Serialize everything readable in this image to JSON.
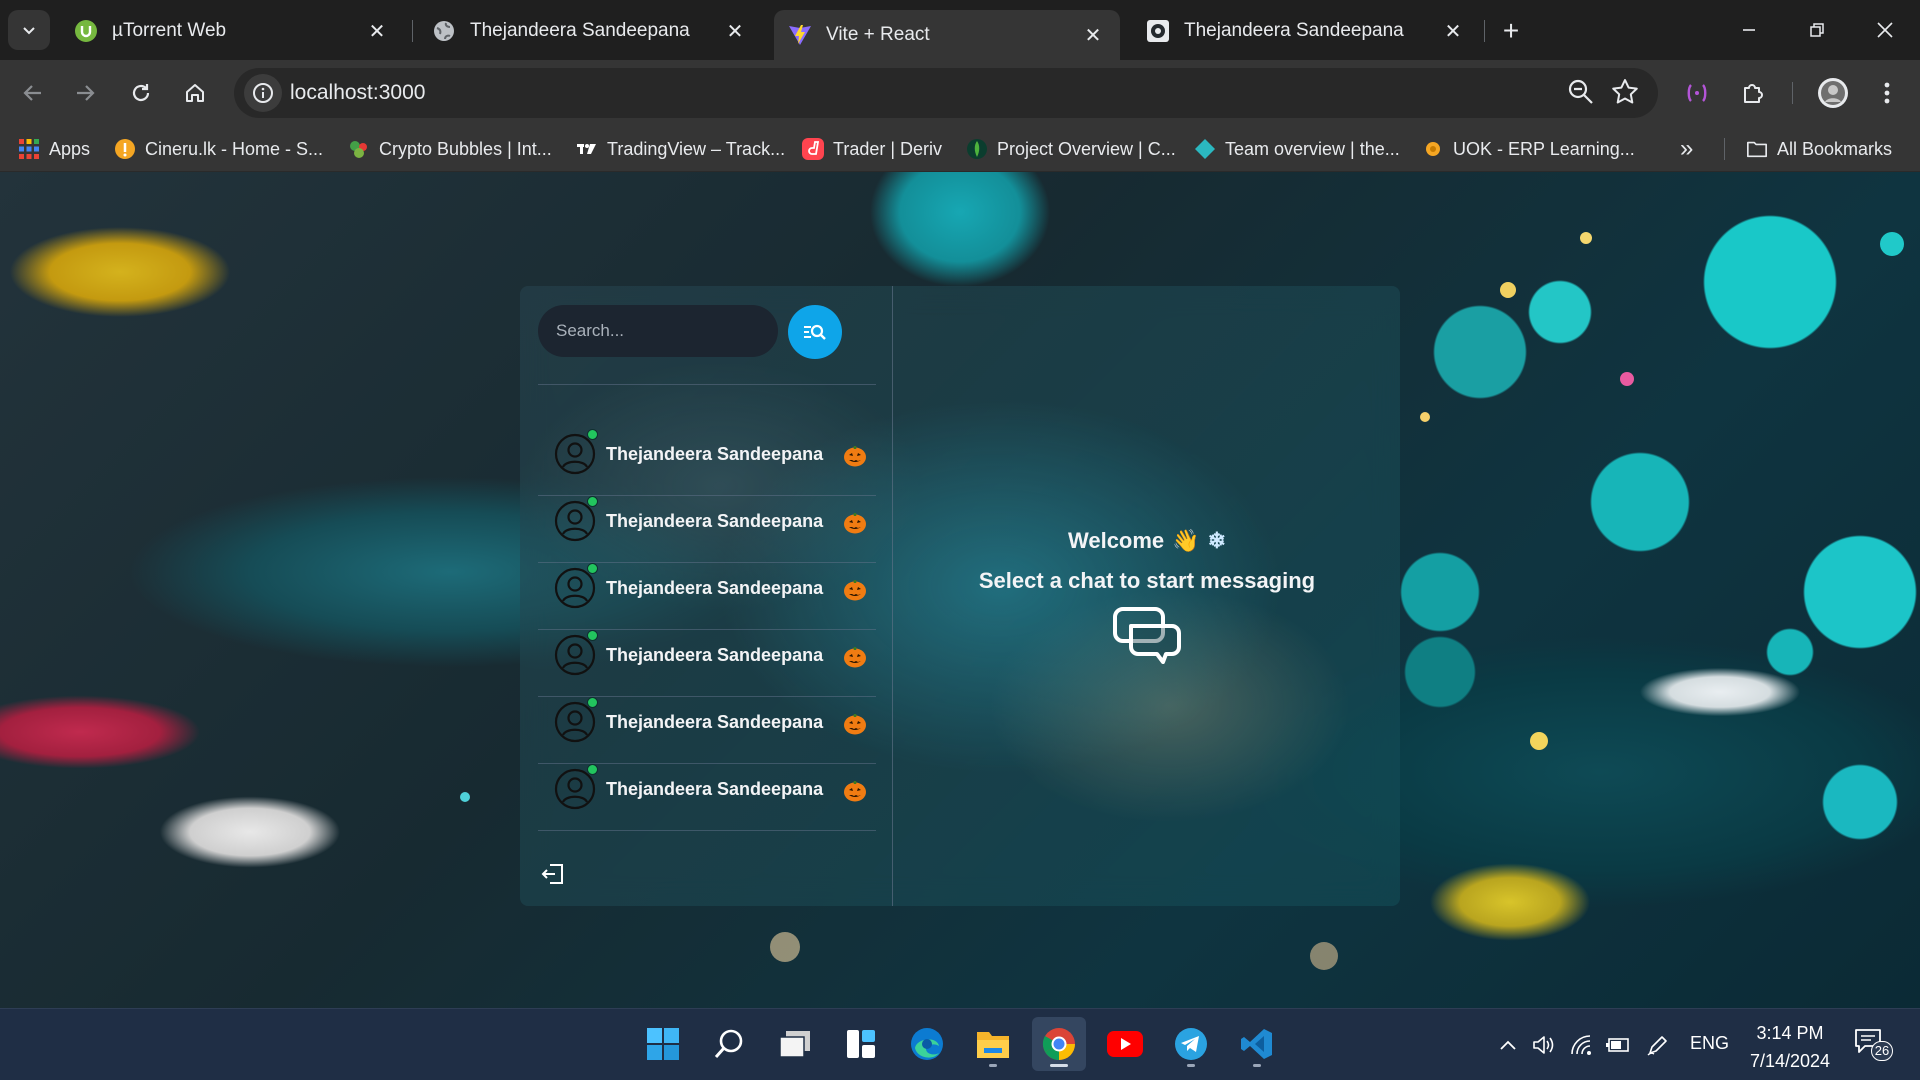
{
  "browser": {
    "tabs": [
      {
        "title": "µTorrent Web",
        "icon": "utorrent-icon",
        "active": false
      },
      {
        "title": "Thejandeera Sandeepana",
        "icon": "globe-icon",
        "active": false
      },
      {
        "title": "Vite + React",
        "icon": "vite-icon",
        "active": true
      },
      {
        "title": "Thejandeera Sandeepana",
        "icon": "github-icon",
        "active": false
      }
    ],
    "close_glyph": "✕",
    "new_tab_glyph": "+",
    "url": "localhost:3000",
    "bookmarks": [
      {
        "label": "Apps",
        "icon": "apps-grid-icon"
      },
      {
        "label": "Cineru.lk - Home - S...",
        "icon": "cineru-icon"
      },
      {
        "label": "Crypto Bubbles | Int...",
        "icon": "crypto-bubbles-icon"
      },
      {
        "label": "TradingView – Track...",
        "icon": "tradingview-icon"
      },
      {
        "label": "Trader | Deriv",
        "icon": "deriv-icon"
      },
      {
        "label": "Project Overview | C...",
        "icon": "mongodb-icon"
      },
      {
        "label": "Team overview | the...",
        "icon": "diamond-icon"
      },
      {
        "label": "UOK - ERP Learning...",
        "icon": "uok-icon"
      }
    ],
    "bookmarks_overflow": "»",
    "all_bookmarks": "All Bookmarks"
  },
  "app": {
    "search_placeholder": "Search...",
    "conversations": [
      {
        "name": "Thejandeera Sandeepana",
        "emoji": "🎃",
        "online": true
      },
      {
        "name": "Thejandeera Sandeepana",
        "emoji": "🎃",
        "online": true
      },
      {
        "name": "Thejandeera Sandeepana",
        "emoji": "🎃",
        "online": true
      },
      {
        "name": "Thejandeera Sandeepana",
        "emoji": "🎃",
        "online": true
      },
      {
        "name": "Thejandeera Sandeepana",
        "emoji": "🎃",
        "online": true
      },
      {
        "name": "Thejandeera Sandeepana",
        "emoji": "🎃",
        "online": true
      }
    ],
    "welcome": {
      "greeting": "Welcome",
      "wave_emoji": "👋",
      "snow_emoji": "❄",
      "subtitle": "Select a chat to start messaging"
    }
  },
  "taskbar": {
    "apps": [
      "windows-start-icon",
      "search-icon",
      "task-view-icon",
      "widgets-icon",
      "edge-icon",
      "file-explorer-icon",
      "chrome-icon",
      "youtube-icon",
      "telegram-icon",
      "vscode-icon"
    ],
    "language": "ENG",
    "time": "3:14 PM",
    "date": "7/14/2024",
    "notification_count": "26"
  },
  "colors": {
    "accent": "#0ea5e9",
    "online": "#22c55e",
    "chrome_frame": "#1f1f1f",
    "chrome_toolbar": "#353535",
    "taskbar": "#1f2e45"
  }
}
